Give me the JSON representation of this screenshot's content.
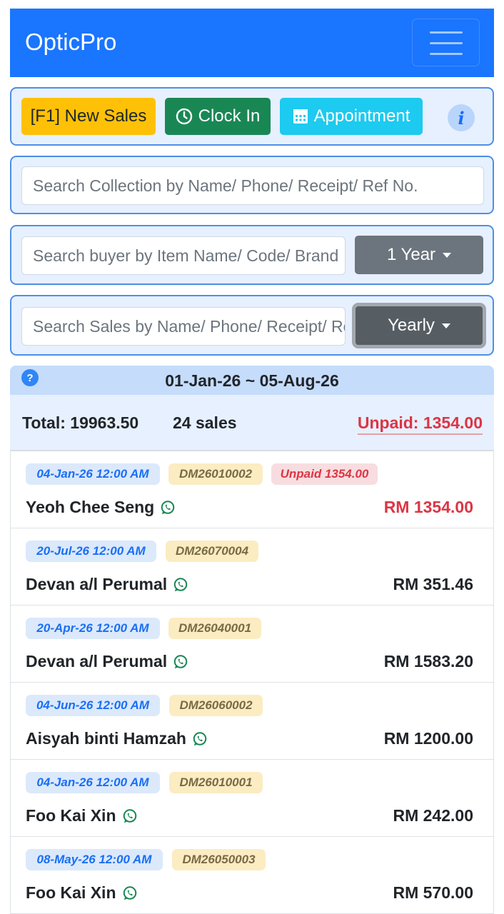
{
  "navbar": {
    "brand": "OpticPro"
  },
  "actions": {
    "new_sales": "[F1] New Sales",
    "clock_in": "Clock In",
    "appointment": "Appointment"
  },
  "search": {
    "collection_placeholder": "Search Collection by Name/ Phone/ Receipt/ Ref No.",
    "buyer_placeholder": "Search buyer by Item Name/ Code/ Brand",
    "buyer_period": "1 Year",
    "sales_placeholder": "Search Sales by Name/ Phone/ Receipt/ Ref No.",
    "sales_period": "Yearly"
  },
  "summary": {
    "range": "01-Jan-26 ~ 05-Aug-26",
    "total": "Total: 19963.50",
    "count": "24 sales",
    "unpaid": "Unpaid: 1354.00"
  },
  "sales": [
    {
      "date": "04-Jan-26 12:00 AM",
      "ref": "DM26010002",
      "unpaid": "Unpaid 1354.00",
      "name": "Yeoh Chee Seng",
      "amount": "RM 1354.00"
    },
    {
      "date": "20-Jul-26 12:00 AM",
      "ref": "DM26070004",
      "name": "Devan a/l Perumal",
      "amount": "RM 351.46"
    },
    {
      "date": "20-Apr-26 12:00 AM",
      "ref": "DM26040001",
      "name": "Devan a/l Perumal",
      "amount": "RM 1583.20"
    },
    {
      "date": "04-Jun-26 12:00 AM",
      "ref": "DM26060002",
      "name": "Aisyah binti Hamzah",
      "amount": "RM 1200.00"
    },
    {
      "date": "04-Jan-26 12:00 AM",
      "ref": "DM26010001",
      "name": "Foo Kai Xin",
      "amount": "RM 242.00"
    },
    {
      "date": "08-May-26 12:00 AM",
      "ref": "DM26050003",
      "name": "Foo Kai Xin",
      "amount": "RM 570.00"
    }
  ],
  "colors": {
    "primary": "#1a75ff",
    "warning": "#ffc107",
    "success": "#198754",
    "info": "#1dcaf0",
    "danger": "#dc3545",
    "secondary": "#6c757d",
    "whatsapp": "#198754"
  },
  "icons": {
    "menu": "hamburger-icon",
    "clock": "clock-icon",
    "calendar": "calendar-icon",
    "info": "info-icon",
    "help": "question-icon",
    "whatsapp": "whatsapp-icon"
  }
}
